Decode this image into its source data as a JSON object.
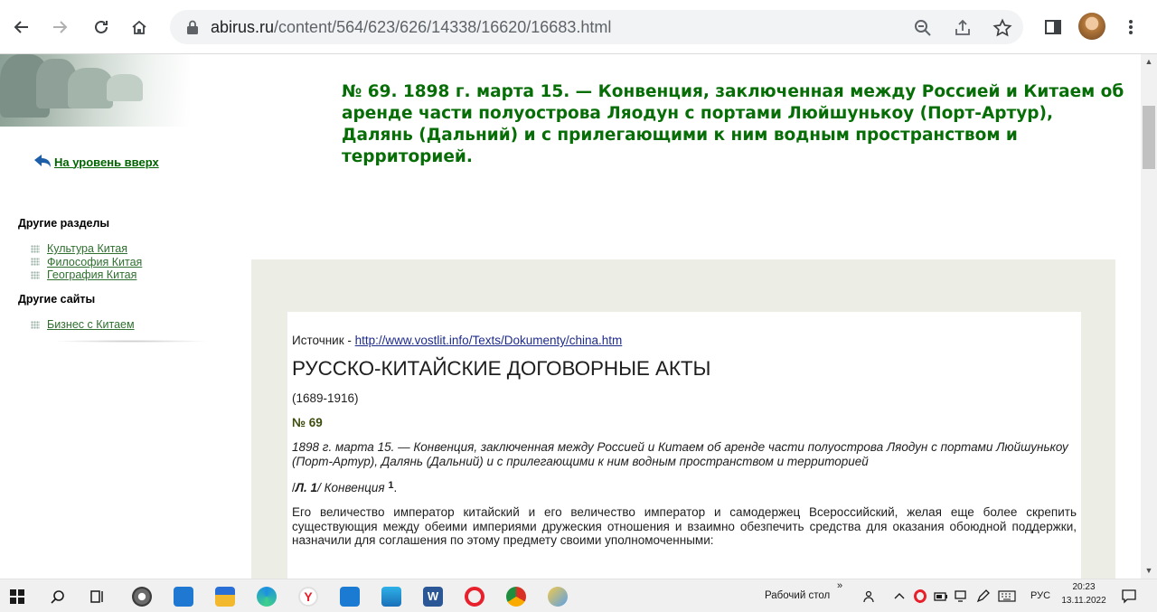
{
  "browser": {
    "url_host": "abirus.ru",
    "url_path": "/content/564/623/626/14338/16620/16683.html"
  },
  "page": {
    "title": "№ 69. 1898 г. марта 15. — Конвенция, заключенная между Россией и Китаем об аренде части полуострова Ляодун с портами Люйшунькоу (Порт-Артур), Далянь (Дальний) и с прилегающими к ним водным пространством и территорией.",
    "uplink_label": "На уровень вверх"
  },
  "sidebar": {
    "sections_heading": "Другие разделы",
    "sections": [
      {
        "label": "Культура Китая"
      },
      {
        "label": "Философия Китая"
      },
      {
        "label": "География Китая"
      }
    ],
    "sites_heading": "Другие сайты",
    "sites": [
      {
        "label": "Бизнес с Китаем"
      }
    ]
  },
  "article": {
    "source_prefix": "Источник - ",
    "source_link": "http://www.vostlit.info/Texts/Dokumenty/china.htm",
    "heading": "РУССКО-КИТАЙСКИЕ ДОГОВОРНЫЕ АКТЫ",
    "years": "(1689-1916)",
    "number": "№ 69",
    "subtitle": "1898 г. марта 15. — Конвенция, заключенная между Россией и Китаем об аренде части полуострова Ляодун с портами Люйшунькоу (Порт-Артур), Далянь (Дальний) и с прилегающими к ним водным пространством и территорией",
    "ref_prefix": "/",
    "ref_sheet": "Л. 1",
    "ref_mid": "/ Конвенция ",
    "ref_note": "1",
    "ref_end": ".",
    "paragraph": "Его величество император китайский и его величество император и самодержец Всероссийский, желая еще более скрепить существующия между обеими империями дружеския отношения и взаимно обезпечить средства для оказания обоюдной поддержки, назначили для соглашения по этому предмету своими уполномоченными:"
  },
  "taskbar": {
    "desktop_label": "Рабочий стол",
    "chevron": "»",
    "lang": "РУС",
    "time": "20:23",
    "date": "13.11.2022"
  },
  "colors": {
    "title_green": "#076e07",
    "panel_bg": "#eceee6"
  }
}
